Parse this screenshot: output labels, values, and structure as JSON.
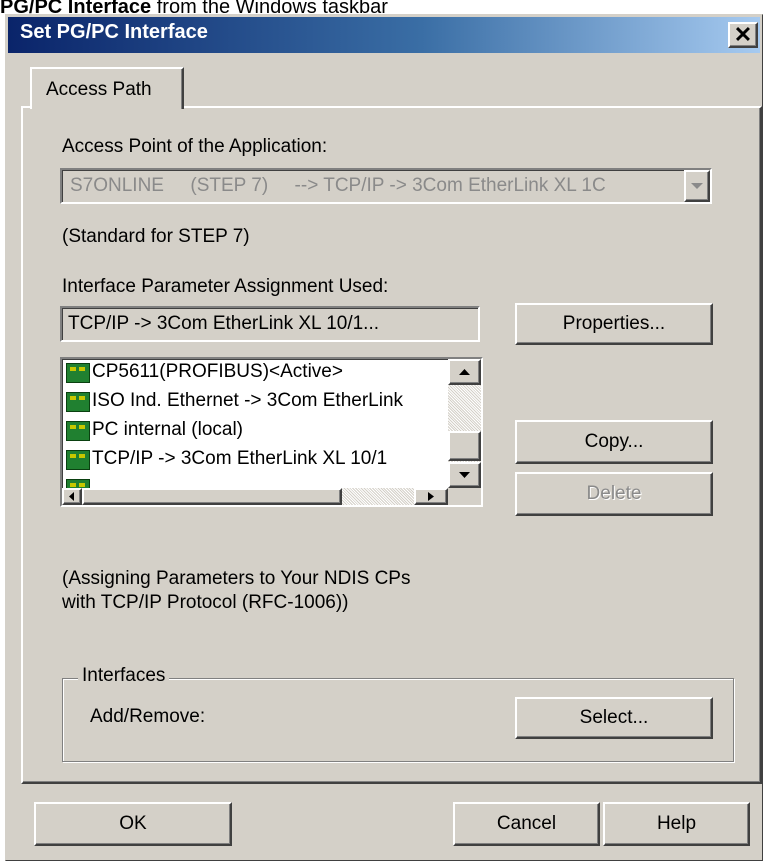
{
  "caption": {
    "bold": "PG/PC Interface",
    "rest": " from the Windows taskbar"
  },
  "dialog": {
    "title": "Set PG/PC Interface",
    "close_glyph": "✕"
  },
  "tabs": [
    {
      "label": "Access Path"
    }
  ],
  "access_point": {
    "label": "Access Point of the Application:",
    "value": "S7ONLINE     (STEP 7)     --> TCP/IP -> 3Com EtherLink XL 1C",
    "note": "(Standard for STEP 7)"
  },
  "interface_param": {
    "label": "Interface Parameter Assignment Used:",
    "value": "TCP/IP -> 3Com EtherLink XL 10/1...",
    "items": [
      {
        "label": "CP5611(PROFIBUS)<Active>"
      },
      {
        "label": "ISO Ind. Ethernet -> 3Com EtherLink"
      },
      {
        "label": "PC internal (local)"
      },
      {
        "label": "TCP/IP -> 3Com EtherLink XL 10/1"
      }
    ],
    "description_line1": "(Assigning Parameters to Your NDIS CPs",
    "description_line2": "with TCP/IP Protocol (RFC-1006))"
  },
  "buttons": {
    "properties": "Properties...",
    "copy": "Copy...",
    "delete": "Delete",
    "select": "Select...",
    "ok": "OK",
    "cancel": "Cancel",
    "help": "Help"
  },
  "interfaces_group": {
    "legend": "Interfaces",
    "add_remove_label": "Add/Remove:"
  },
  "colors": {
    "title_gradient_start": "#0a246a",
    "title_gradient_end": "#a6caf0",
    "dialog_face": "#d4d0c8",
    "disabled_text": "#8a8a8a"
  },
  "icons": {
    "network_card": "network-card-icon",
    "scroll_up": "arrow-up-icon",
    "scroll_down": "arrow-down-icon",
    "scroll_left": "arrow-left-icon",
    "scroll_right": "arrow-right-icon",
    "dropdown": "chevron-down-icon"
  }
}
